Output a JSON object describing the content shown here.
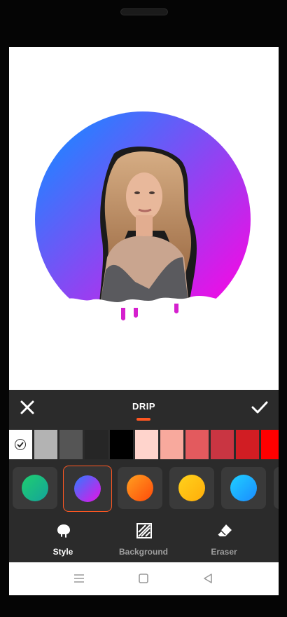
{
  "editor": {
    "title": "DRIP",
    "close_icon": "close-icon",
    "confirm_icon": "check-icon"
  },
  "colors": {
    "accent": "#ff5722",
    "panel_bg": "#2b2b2b",
    "swatches": [
      "#ffffff",
      "#b3b3b3",
      "#555555",
      "#262626",
      "#000000",
      "#ffd4cc",
      "#f8a99d",
      "#e35a5e",
      "#c93542",
      "#d11d23",
      "#ff0000"
    ],
    "styles": [
      {
        "name": "green",
        "from": "#1fcf6f",
        "to": "#14a39a"
      },
      {
        "name": "blue-purple",
        "from": "#2f7bff",
        "to": "#e612e6"
      },
      {
        "name": "orange",
        "from": "#ffa020",
        "to": "#ff4a0a"
      },
      {
        "name": "yellow",
        "from": "#ffd21c",
        "to": "#ffad0a"
      },
      {
        "name": "cyan",
        "from": "#1fd0ff",
        "to": "#1b8bff"
      }
    ]
  },
  "tabs": [
    {
      "label": "Style",
      "icon": "drip-icon",
      "active": true
    },
    {
      "label": "Background",
      "icon": "background-hatch-icon",
      "active": false
    },
    {
      "label": "Eraser",
      "icon": "eraser-icon",
      "active": false
    }
  ],
  "system_nav": {
    "menu_icon": "menu-icon",
    "home_icon": "home-square-icon",
    "back_icon": "back-triangle-icon"
  }
}
